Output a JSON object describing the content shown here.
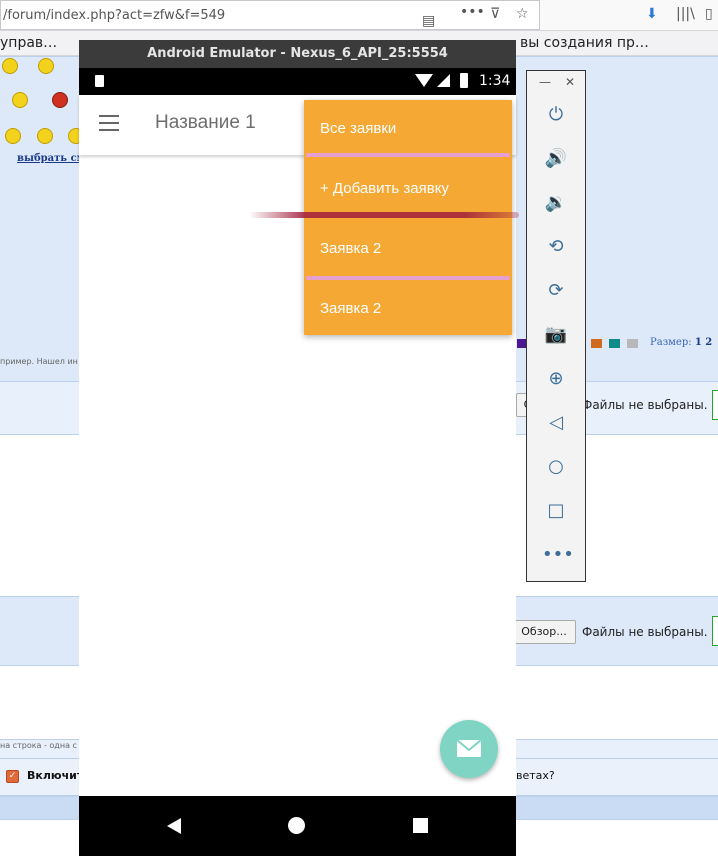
{
  "browser": {
    "url": "/forum/index.php?act=zfw&f=549",
    "bookmark_left": "управ…",
    "bookmark_right": "вы создания пр…"
  },
  "forum": {
    "choose_smilies_link": "выбрать см",
    "size_label": "Размер:",
    "size_values": "1 2",
    "example_text": "пример. Нашел ин",
    "files_not_selected": "Файлы не выбраны.",
    "browse_button": "Обзор...",
    "browse_button_partial": "О",
    "line_hint": "на строка - одна с",
    "include_label": "Включить",
    "answers_label": "ветах?"
  },
  "emulator": {
    "window_title": "Android Emulator - Nexus_6_API_25:5554",
    "status_time": "1:34",
    "app_title": "Название 1",
    "menu_items": [
      "Все заявки",
      "+ Добавить заявку",
      "Заявка 2",
      "Заявка 2"
    ],
    "fab_icon": "envelope-icon"
  },
  "toolbar": {
    "icons": [
      "power-icon",
      "volume-up-icon",
      "volume-down-icon",
      "rotate-left-icon",
      "rotate-right-icon",
      "camera-icon",
      "zoom-icon",
      "back-icon",
      "home-icon",
      "overview-icon",
      "more-icon"
    ],
    "accent": "#3d6e98"
  },
  "colors": {
    "menu_bg": "#f6a834",
    "fab_bg": "#7fd4c4",
    "forum_band": "#dde9f8"
  }
}
